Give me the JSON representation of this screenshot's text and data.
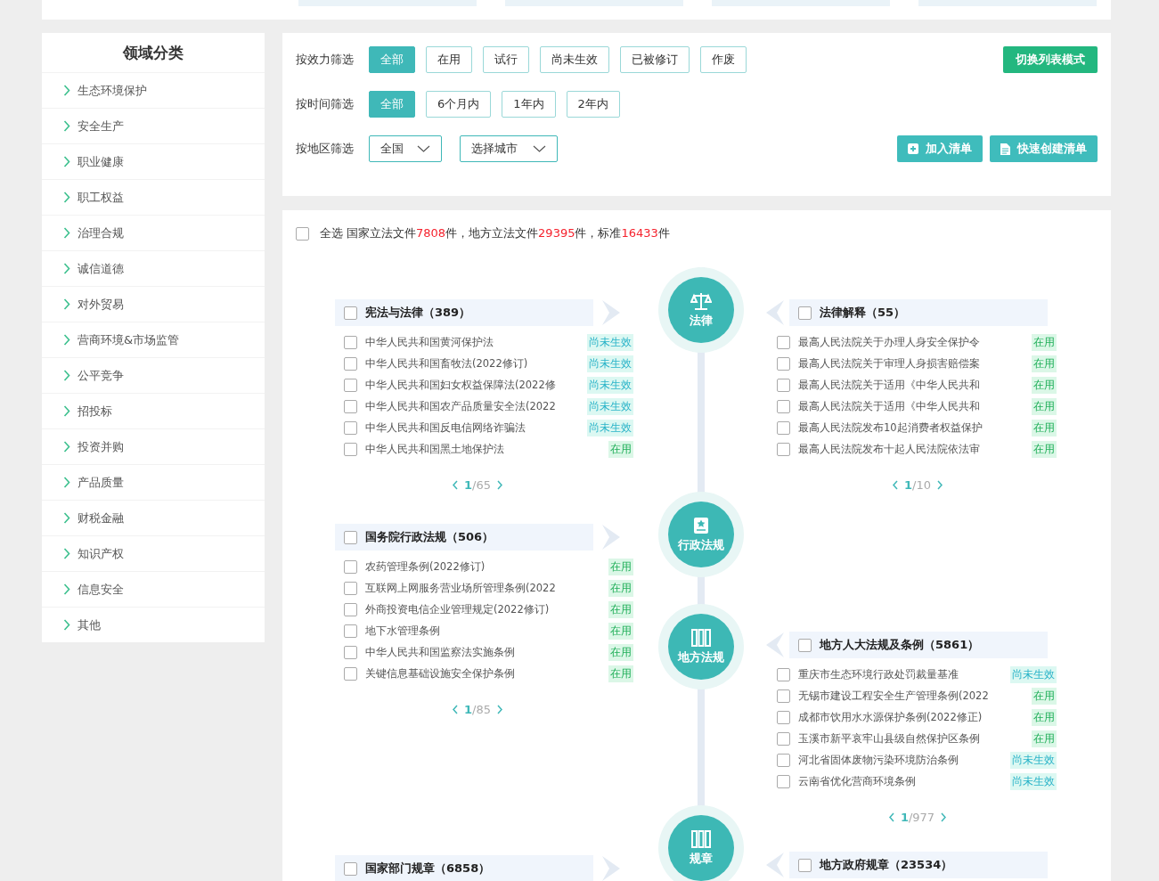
{
  "sidebar": {
    "title": "领域分类",
    "items": [
      {
        "label": "生态环境保护"
      },
      {
        "label": "安全生产"
      },
      {
        "label": "职业健康"
      },
      {
        "label": "职工权益"
      },
      {
        "label": "治理合规"
      },
      {
        "label": "诚信道德"
      },
      {
        "label": "对外贸易"
      },
      {
        "label": "营商环境&市场监管"
      },
      {
        "label": "公平竞争"
      },
      {
        "label": "招投标"
      },
      {
        "label": "投资并购"
      },
      {
        "label": "产品质量"
      },
      {
        "label": "财税金融"
      },
      {
        "label": "知识产权"
      },
      {
        "label": "信息安全"
      },
      {
        "label": "其他"
      }
    ]
  },
  "filters": {
    "rows": [
      {
        "kind": "buttons",
        "label": "按效力筛选",
        "options": [
          {
            "label": "全部",
            "selected": true
          },
          {
            "label": "在用",
            "selected": false
          },
          {
            "label": "试行",
            "selected": false
          },
          {
            "label": "尚未生效",
            "selected": false
          },
          {
            "label": "已被修订",
            "selected": false
          },
          {
            "label": "作废",
            "selected": false
          }
        ]
      },
      {
        "kind": "buttons",
        "label": "按时间筛选",
        "options": [
          {
            "label": "全部",
            "selected": true
          },
          {
            "label": "6个月内",
            "selected": false
          },
          {
            "label": "1年内",
            "selected": false
          },
          {
            "label": "2年内",
            "selected": false
          }
        ]
      },
      {
        "kind": "dropdowns",
        "label": "按地区筛选",
        "dropdowns": [
          "全国",
          "选择城市"
        ]
      }
    ],
    "toggle_button": "切换列表模式",
    "actions": [
      {
        "label": "加入清单",
        "kind": "add"
      },
      {
        "label": "快速创建清单",
        "kind": "doc"
      }
    ]
  },
  "summary": {
    "select_all": {
      "label": "全选",
      "checked": false
    },
    "segments": [
      {
        "text": "国家立法文件",
        "highlight": false
      },
      {
        "text": "7808",
        "highlight": true
      },
      {
        "text": "件，地方立法文件",
        "highlight": false
      },
      {
        "text": "29395",
        "highlight": true
      },
      {
        "text": "件，标准",
        "highlight": false
      },
      {
        "text": "16433",
        "highlight": true
      },
      {
        "text": "件",
        "highlight": false
      }
    ]
  },
  "timeline": {
    "nodes": [
      {
        "label": "法律",
        "kind": "scale"
      },
      {
        "label": "行政法规",
        "kind": "book"
      },
      {
        "label": "地方法规",
        "kind": "shelf"
      },
      {
        "label": "规章",
        "kind": "shelf"
      }
    ],
    "left_groups": [
      {
        "title": "宪法与法律（389）",
        "checked": false,
        "items": [
          {
            "title": "中华人民共和国黄河保护法",
            "checked": false,
            "status": "尚未生效",
            "kind": "pending"
          },
          {
            "title": "中华人民共和国畜牧法(2022修订)",
            "checked": false,
            "status": "尚未生效",
            "kind": "pending"
          },
          {
            "title": "中华人民共和国妇女权益保障法(2022修",
            "checked": false,
            "status": "尚未生效",
            "kind": "pending"
          },
          {
            "title": "中华人民共和国农产品质量安全法(2022",
            "checked": false,
            "status": "尚未生效",
            "kind": "pending"
          },
          {
            "title": "中华人民共和国反电信网络诈骗法",
            "checked": false,
            "status": "尚未生效",
            "kind": "pending"
          },
          {
            "title": "中华人民共和国黑土地保护法",
            "checked": false,
            "status": "在用",
            "kind": "active"
          }
        ],
        "page": "1",
        "page_total": "/65"
      },
      {
        "title": "国务院行政法规（506）",
        "checked": false,
        "items": [
          {
            "title": "农药管理条例(2022修订)",
            "checked": false,
            "status": "在用",
            "kind": "active"
          },
          {
            "title": "互联网上网服务营业场所管理条例(2022",
            "checked": false,
            "status": "在用",
            "kind": "active"
          },
          {
            "title": "外商投资电信企业管理规定(2022修订)",
            "checked": false,
            "status": "在用",
            "kind": "active"
          },
          {
            "title": "地下水管理条例",
            "checked": false,
            "status": "在用",
            "kind": "active"
          },
          {
            "title": "中华人民共和国监察法实施条例",
            "checked": false,
            "status": "在用",
            "kind": "active"
          },
          {
            "title": "关键信息基础设施安全保护条例",
            "checked": false,
            "status": "在用",
            "kind": "active"
          }
        ],
        "page": "1",
        "page_total": "/85"
      },
      {
        "title": "国家部门规章（6858）",
        "checked": false
      }
    ],
    "right_groups": [
      {
        "title": "法律解释（55）",
        "checked": false,
        "items": [
          {
            "title": "最高人民法院关于办理人身安全保护令",
            "checked": false,
            "status": "在用",
            "kind": "active"
          },
          {
            "title": "最高人民法院关于审理人身损害赔偿案",
            "checked": false,
            "status": "在用",
            "kind": "active"
          },
          {
            "title": "最高人民法院关于适用《中华人民共和",
            "checked": false,
            "status": "在用",
            "kind": "active"
          },
          {
            "title": "最高人民法院关于适用《中华人民共和",
            "checked": false,
            "status": "在用",
            "kind": "active"
          },
          {
            "title": "最高人民法院发布10起消费者权益保护",
            "checked": false,
            "status": "在用",
            "kind": "active"
          },
          {
            "title": "最高人民法院发布十起人民法院依法审",
            "checked": false,
            "status": "在用",
            "kind": "active"
          }
        ],
        "page": "1",
        "page_total": "/10"
      },
      {
        "title": "地方人大法规及条例（5861）",
        "checked": false,
        "items": [
          {
            "title": "重庆市生态环境行政处罚裁量基准",
            "checked": false,
            "status": "尚未生效",
            "kind": "pending"
          },
          {
            "title": "无锡市建设工程安全生产管理条例(2022",
            "checked": false,
            "status": "在用",
            "kind": "active"
          },
          {
            "title": "成都市饮用水水源保护条例(2022修正)",
            "checked": false,
            "status": "在用",
            "kind": "active"
          },
          {
            "title": "玉溪市新平哀牢山县级自然保护区条例",
            "checked": false,
            "status": "在用",
            "kind": "active"
          },
          {
            "title": "河北省固体废物污染环境防治条例",
            "checked": false,
            "status": "尚未生效",
            "kind": "pending"
          },
          {
            "title": "云南省优化营商环境条例",
            "checked": false,
            "status": "尚未生效",
            "kind": "pending"
          }
        ],
        "page": "1",
        "page_total": "/977"
      },
      {
        "title": "地方政府规章（23534）",
        "checked": false
      }
    ]
  }
}
